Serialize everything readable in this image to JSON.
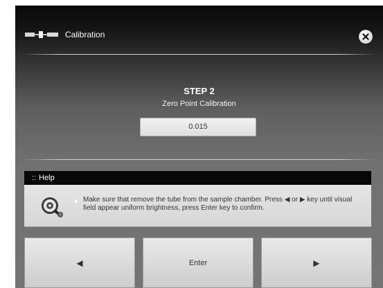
{
  "header": {
    "title": "Calibration",
    "logo_icon": "calibration-tube-icon",
    "close_icon": "close-icon"
  },
  "step": {
    "title": "STEP 2",
    "subtitle": "Zero Point Calibration",
    "value": "0.015"
  },
  "help": {
    "header_dots": "::",
    "header_label": "Help",
    "icon": "magnifier-help-icon",
    "text": "Make sure that remove the tube from the sample chamber. Press ◀ or ▶ key until visual field appear uniform brightness, press Enter key to confirm."
  },
  "buttons": {
    "left_glyph": "◀",
    "left_icon": "left-arrow-icon",
    "enter_label": "Enter",
    "right_glyph": "▶",
    "right_icon": "right-arrow-icon"
  },
  "colors": {
    "header_bg": "#0a0a0a",
    "panel_bg": "#747474",
    "help_header_bg": "#080808",
    "button_bg": "#e9e9e9"
  }
}
